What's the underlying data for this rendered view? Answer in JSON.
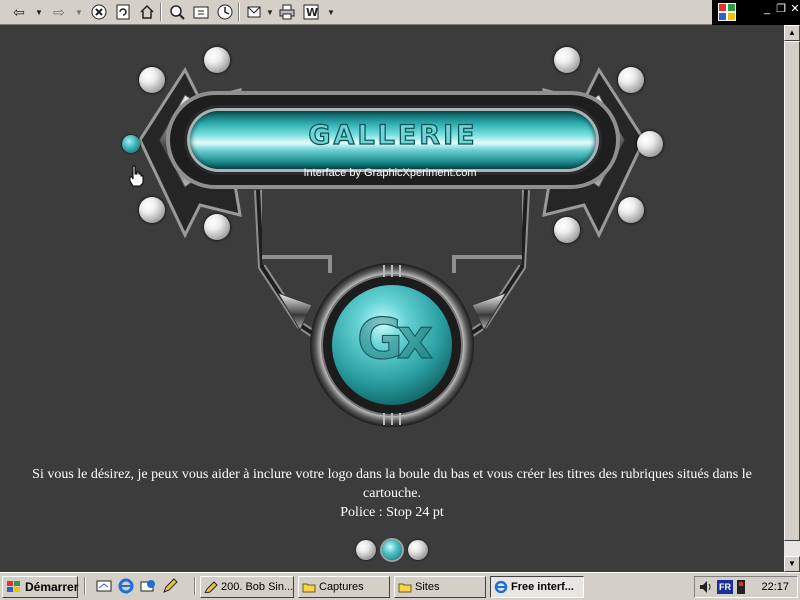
{
  "browser": {
    "toolbar_icons": [
      "back-arrow-icon",
      "forward-arrow-icon",
      "stop-icon",
      "refresh-icon",
      "home-icon",
      "search-icon",
      "favorites-icon",
      "history-icon",
      "mail-icon",
      "print-icon",
      "edit-word-icon"
    ]
  },
  "gallery": {
    "title": "GALLERIE",
    "credit": "Interface by GraphicXperiment.com",
    "logo_text": "Gx",
    "description_line1": "Si vous le désirez, je peux vous aider à inclure votre logo dans la boule du bas et vous créer les titres des rubriques situés dans le cartouche.",
    "description_line2": "Police : Stop 24 pt",
    "colors": {
      "background": "#3d3c3d",
      "accent": "#2eaeb1",
      "text": "#ffffff"
    }
  },
  "taskbar": {
    "start_label": "Démarrer",
    "tasks": [
      {
        "label": "200. Bob Sin...",
        "active": false
      },
      {
        "label": "Captures",
        "active": false
      },
      {
        "label": "Sites",
        "active": false
      },
      {
        "label": "Free interf...",
        "active": true
      }
    ],
    "language": "FR",
    "clock": "22:17"
  }
}
